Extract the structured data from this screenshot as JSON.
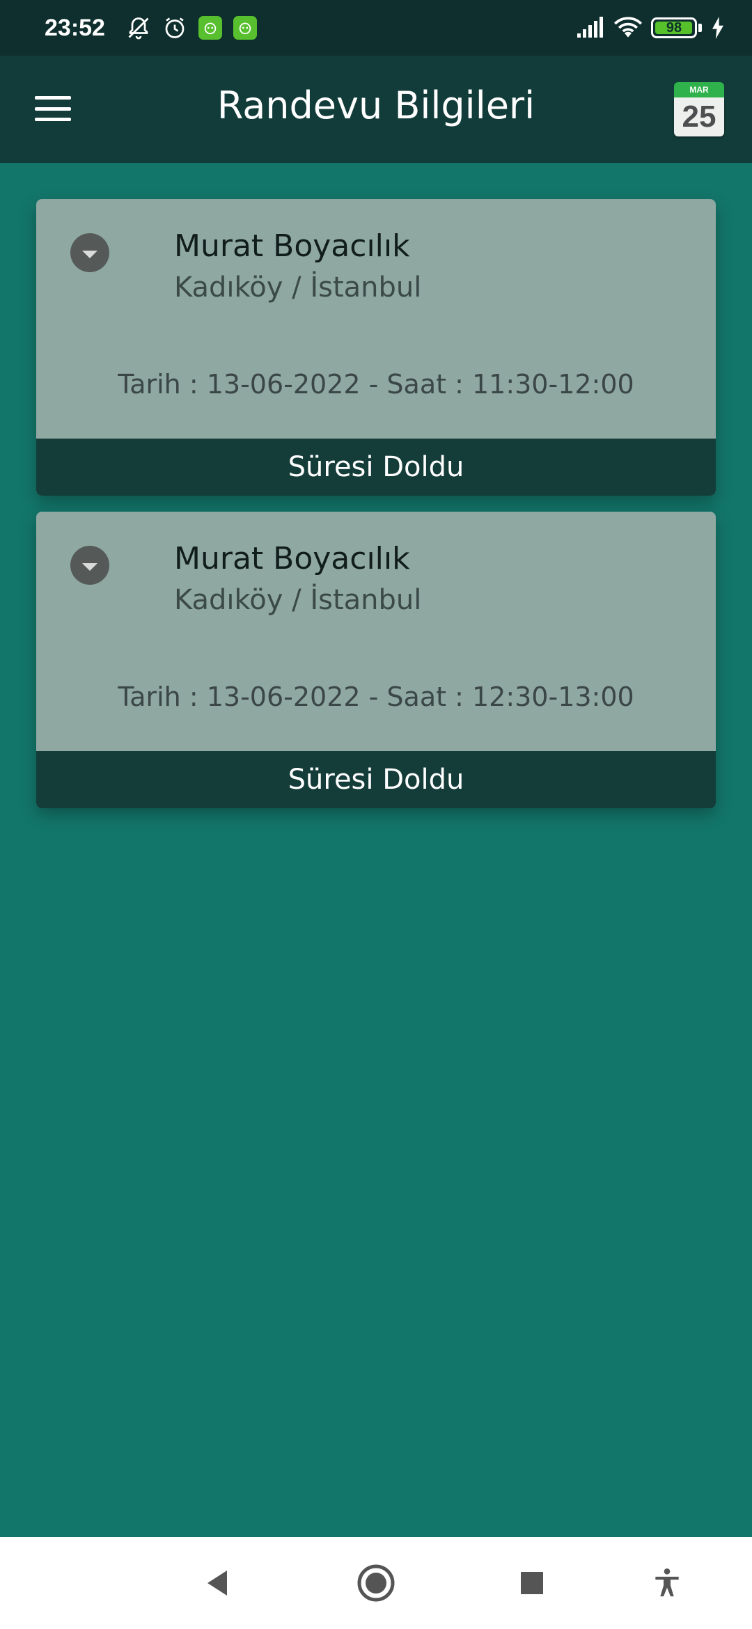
{
  "status_bar": {
    "time": "23:52",
    "battery_level": "98",
    "icons": [
      "bell-off-icon",
      "alarm-clock-icon",
      "app-notification-icon",
      "app-notification-icon",
      "signal-icon",
      "wifi-icon",
      "battery-icon",
      "charging-icon"
    ]
  },
  "app_bar": {
    "title": "Randevu Bilgileri",
    "calendar_month": "MAR",
    "calendar_day": "25"
  },
  "appointments": [
    {
      "name": "Murat Boyacılık",
      "location": "Kadıköy / İstanbul",
      "datetime": "Tarih : 13-06-2022 - Saat : 11:30-12:00",
      "status": "Süresi Doldu"
    },
    {
      "name": "Murat Boyacılık",
      "location": "Kadıköy / İstanbul",
      "datetime": "Tarih : 13-06-2022 - Saat : 12:30-13:00",
      "status": "Süresi Doldu"
    }
  ],
  "colors": {
    "background": "#13766a",
    "app_bar": "#123c39",
    "card": "#8fa8a2",
    "card_status": "#143d3a",
    "status_bar": "#0e2f2d"
  }
}
